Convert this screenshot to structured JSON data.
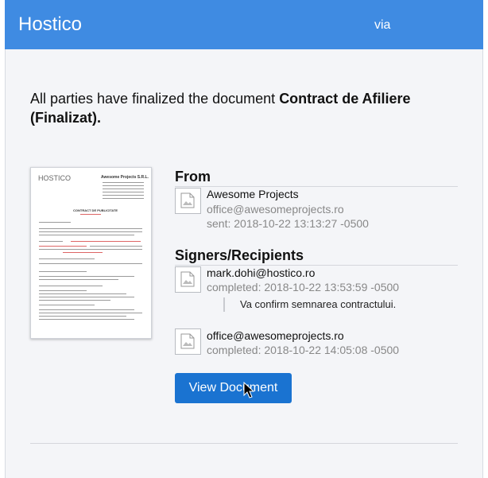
{
  "header": {
    "brand": "Hostico",
    "via": "via"
  },
  "message": {
    "prefix": "All parties have finalized the document ",
    "document_name": "Contract de Afiliere (Finalizat)."
  },
  "document_preview": {
    "logo_text": "HOSTICO",
    "company": "Awesome Projects S.R.L.",
    "title": "CONTRACT DE PUBLICITATE"
  },
  "from": {
    "heading": "From",
    "name": "Awesome Projects",
    "email": "office@awesomeprojects.ro",
    "sent": "sent: 2018-10-22 13:13:27 -0500"
  },
  "signers": {
    "heading": "Signers/Recipients",
    "items": [
      {
        "email": "mark.dohi@hostico.ro",
        "status": "completed: 2018-10-22 13:53:59 -0500",
        "comment": "Va confirm semnarea contractului."
      },
      {
        "email": "office@awesomeprojects.ro",
        "status": "completed: 2018-10-22 14:05:08 -0500"
      }
    ]
  },
  "actions": {
    "view_document": "View Document"
  },
  "colors": {
    "header": "#3f8be2",
    "button": "#1a73d1",
    "background": "#f4f5f8"
  }
}
